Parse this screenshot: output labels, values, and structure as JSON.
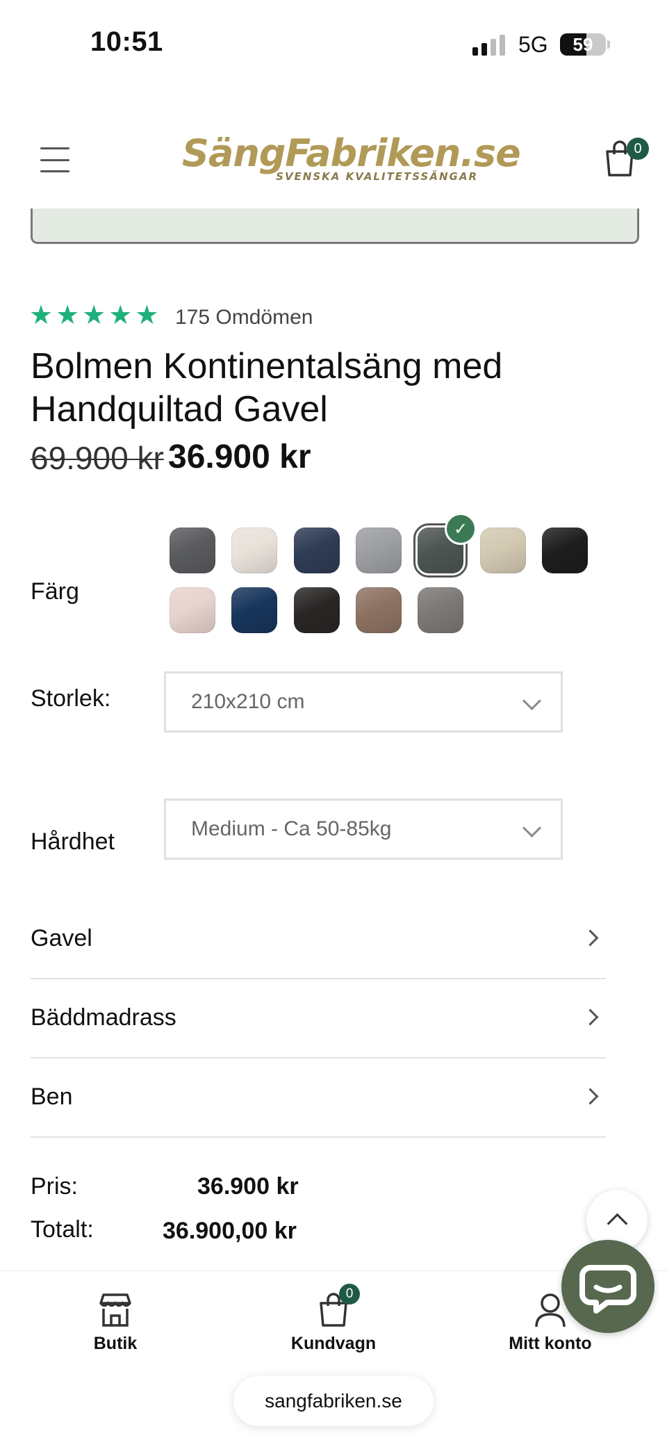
{
  "status_bar": {
    "time": "10:51",
    "network": "5G",
    "battery": "59"
  },
  "header": {
    "logo_text": "SängFabriken.se",
    "logo_tagline": "SVENSKA KVALITETSSÄNGAR",
    "cart_count": "0",
    "brand_color": "#b19a57",
    "accent_color": "#1f5a45"
  },
  "product": {
    "rating_stars": "★★★★★",
    "reviews_label": "175 Omdömen",
    "title": "Bolmen Kontinentalsäng med Handquiltad Gavel",
    "old_price": "69.900 kr",
    "price": "36.900 kr"
  },
  "options": {
    "color_label": "Färg",
    "colors": [
      {
        "name": "dark-grey",
        "hex": "#5a5b5f"
      },
      {
        "name": "cream",
        "hex": "#e8e2da"
      },
      {
        "name": "navy",
        "hex": "#2f3c55"
      },
      {
        "name": "light-grey",
        "hex": "#9c9ea2"
      },
      {
        "name": "charcoal-selected",
        "hex": "#4d5553"
      },
      {
        "name": "beige",
        "hex": "#d3c9b2"
      },
      {
        "name": "black",
        "hex": "#1d1d1f"
      },
      {
        "name": "blush",
        "hex": "#e7d3cd"
      },
      {
        "name": "midnight-blue",
        "hex": "#18355c"
      },
      {
        "name": "espresso",
        "hex": "#2a2626"
      },
      {
        "name": "mocha",
        "hex": "#8d7263"
      },
      {
        "name": "taupe-grey",
        "hex": "#7c7876"
      }
    ],
    "selected_color_index": 4,
    "size_label": "Storlek:",
    "size_value": "210x210 cm",
    "firmness_label": "Hårdhet",
    "firmness_value": "Medium - Ca 50-85kg"
  },
  "accordion": [
    {
      "label": "Gavel"
    },
    {
      "label": "Bäddmadrass"
    },
    {
      "label": "Ben"
    }
  ],
  "totals": {
    "price_label": "Pris:",
    "price_value": "36.900 kr",
    "total_label": "Totalt:",
    "total_value": "36.900,00 kr"
  },
  "bottom_nav": {
    "shop_label": "Butik",
    "cart_label": "Kundvagn",
    "cart_count": "0",
    "account_label": "Mitt konto"
  },
  "browser": {
    "url": "sangfabriken.se"
  }
}
